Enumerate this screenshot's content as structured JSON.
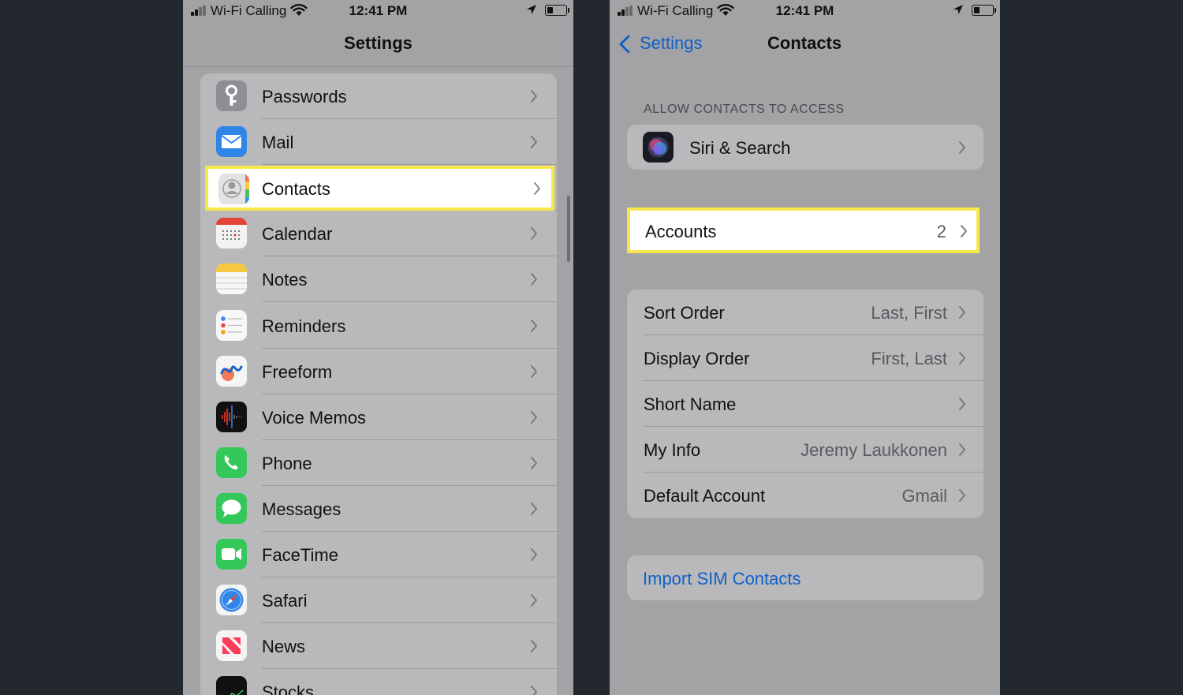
{
  "status": {
    "carrier": "Wi-Fi Calling",
    "time": "12:41 PM"
  },
  "left": {
    "title": "Settings",
    "items": [
      {
        "label": "Passwords",
        "icon": "passwords-icon"
      },
      {
        "label": "Mail",
        "icon": "mail-icon"
      },
      {
        "label": "Contacts",
        "icon": "contacts-icon"
      },
      {
        "label": "Calendar",
        "icon": "calendar-icon"
      },
      {
        "label": "Notes",
        "icon": "notes-icon"
      },
      {
        "label": "Reminders",
        "icon": "reminders-icon"
      },
      {
        "label": "Freeform",
        "icon": "freeform-icon"
      },
      {
        "label": "Voice Memos",
        "icon": "voice-memos-icon"
      },
      {
        "label": "Phone",
        "icon": "phone-icon"
      },
      {
        "label": "Messages",
        "icon": "messages-icon"
      },
      {
        "label": "FaceTime",
        "icon": "facetime-icon"
      },
      {
        "label": "Safari",
        "icon": "safari-icon"
      },
      {
        "label": "News",
        "icon": "news-icon"
      },
      {
        "label": "Stocks",
        "icon": "stocks-icon"
      }
    ]
  },
  "right": {
    "back_label": "Settings",
    "title": "Contacts",
    "section_header": "ALLOW CONTACTS TO ACCESS",
    "siri_label": "Siri & Search",
    "accounts": {
      "label": "Accounts",
      "value": "2"
    },
    "settings": [
      {
        "label": "Sort Order",
        "value": "Last, First"
      },
      {
        "label": "Display Order",
        "value": "First, Last"
      },
      {
        "label": "Short Name",
        "value": ""
      },
      {
        "label": "My Info",
        "value": "Jeremy Laukkonen"
      },
      {
        "label": "Default Account",
        "value": "Gmail"
      }
    ],
    "import_label": "Import SIM Contacts"
  },
  "colors": {
    "screen_bg": "#a3a3a6",
    "group_bg": "#b9b9bc",
    "highlight_border": "#f6e84a",
    "link_blue": "#1060c8",
    "page_bg": "#23272e"
  }
}
